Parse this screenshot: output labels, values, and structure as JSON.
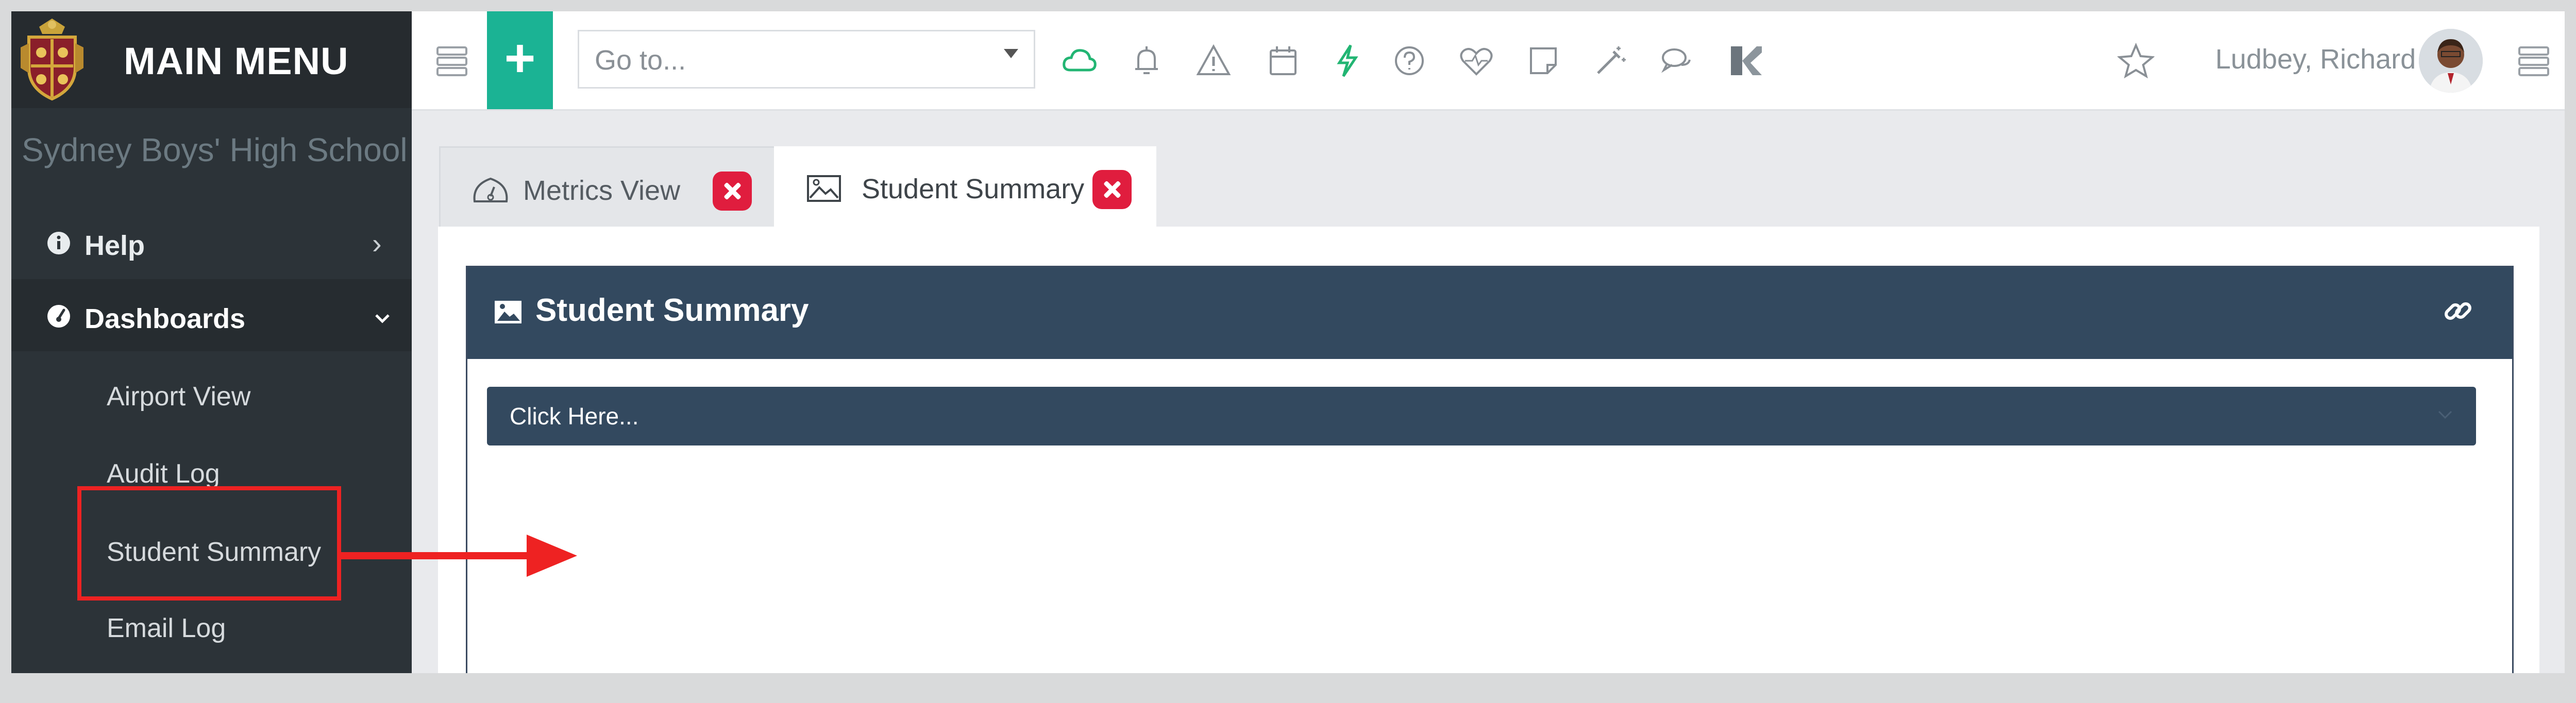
{
  "brand": {
    "title": "MAIN MENU"
  },
  "sidebar": {
    "school": "Sydney Boys' High School",
    "help": {
      "label": "Help",
      "chevron": "›",
      "icon": "info-circle-icon"
    },
    "dashboards": {
      "label": "Dashboards",
      "chevron": "⌄",
      "icon": "dashboard-gauge-icon",
      "items": [
        {
          "label": "Airport View"
        },
        {
          "label": "Audit Log"
        },
        {
          "label": "Student Summary",
          "highlighted": true
        },
        {
          "label": "Email Log"
        }
      ]
    }
  },
  "topbar": {
    "add_label": "+",
    "goto_placeholder": "Go to...",
    "icons": [
      "menu-icon",
      "cloud-icon",
      "bell-icon",
      "warning-icon",
      "calendar-icon",
      "bolt-icon",
      "help-icon",
      "heartbeat-icon",
      "note-icon",
      "magic-wand-icon",
      "chat-icon",
      "k-logo-icon",
      "star-icon",
      "hamburger-icon"
    ],
    "user_name": "Ludbey, Richard"
  },
  "tabs": [
    {
      "label": "Metrics View",
      "icon": "gauge-icon",
      "active": false
    },
    {
      "label": "Student Summary",
      "icon": "image-icon",
      "active": true
    }
  ],
  "panel": {
    "title": "Student Summary",
    "dropdown_label": "Click Here..."
  },
  "colors": {
    "sidebar_bg": "#2c3338",
    "accent_green": "#1bb394",
    "panel_header": "#33495f",
    "close_red": "#e01d3e",
    "annotation_red": "#ee2222"
  }
}
